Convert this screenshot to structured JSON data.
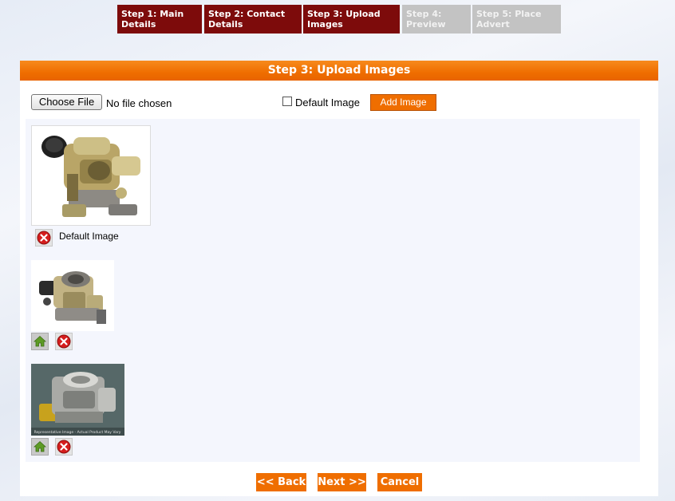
{
  "steps": [
    {
      "line1": "Step 1: Main",
      "line2": "Details",
      "state": "active"
    },
    {
      "line1": "Step 2: Contact",
      "line2": "Details",
      "state": "active"
    },
    {
      "line1": "Step 3: Upload",
      "line2": "Images",
      "state": "active"
    },
    {
      "line1": "Step 4:",
      "line2": "Preview",
      "state": "inactive"
    },
    {
      "line1": "Step 5: Place",
      "line2": "Advert",
      "state": "inactive"
    }
  ],
  "panel": {
    "title": "Step 3: Upload Images"
  },
  "upload": {
    "choose_file_label": "Choose File",
    "file_status": "No file chosen",
    "default_image_label": "Default Image",
    "default_image_checked": false,
    "add_image_label": "Add Image"
  },
  "images": [
    {
      "icon": "carburetor-photo",
      "is_default": true,
      "default_label": "Default Image",
      "controls": [
        "delete-icon"
      ]
    },
    {
      "icon": "carburetor-photo",
      "is_default": false,
      "controls": [
        "set-default-home-icon",
        "delete-icon"
      ]
    },
    {
      "icon": "carburetor-photo",
      "is_default": false,
      "caption": "Representative Image - Actual Product May Vary",
      "controls": [
        "set-default-home-icon",
        "delete-icon"
      ]
    }
  ],
  "nav": {
    "back_label": "<< Back",
    "next_label": "Next >>",
    "cancel_label": "Cancel"
  },
  "colors": {
    "accent_orange": "#ef6e00",
    "step_active": "#7d0b0b",
    "step_inactive": "#c3c3c3"
  }
}
